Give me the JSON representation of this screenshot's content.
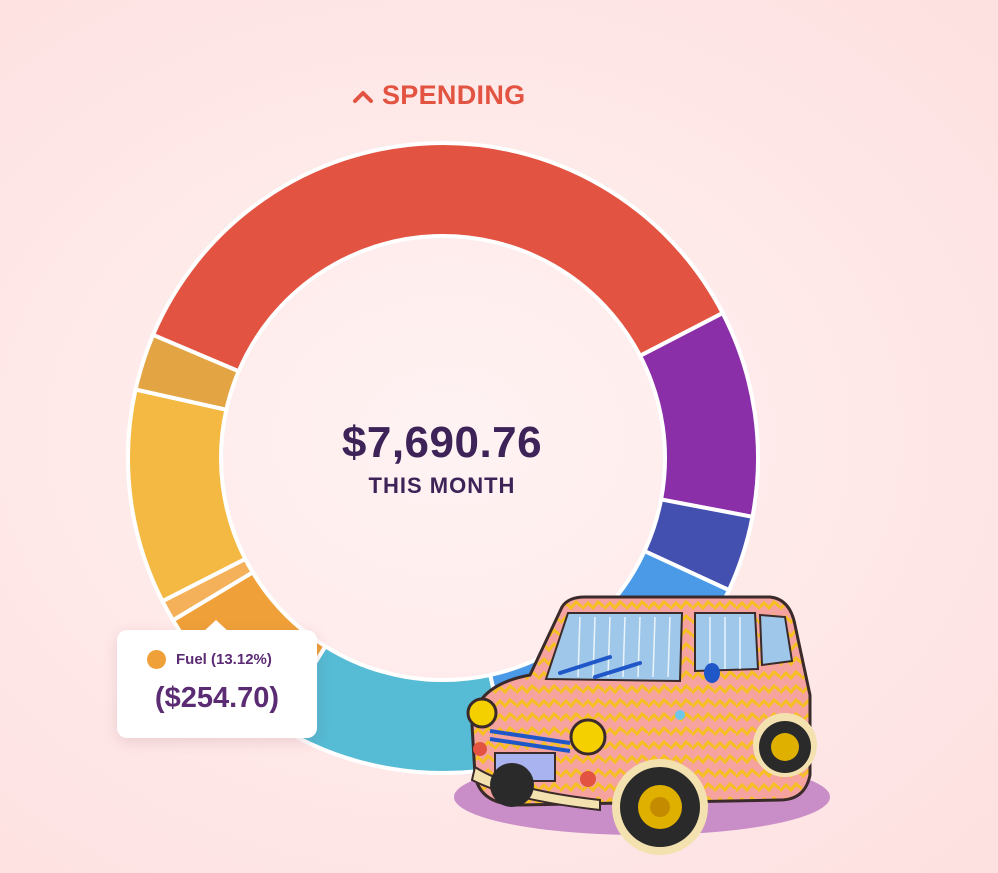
{
  "header": {
    "label": "SPENDING",
    "icon": "chevron-up-icon"
  },
  "summary": {
    "total": "$7,690.76",
    "period": "THIS MONTH"
  },
  "tooltip": {
    "label": "Fuel (13.12%)",
    "amount": "($254.70)",
    "color": "#f0a038"
  },
  "chart_data": {
    "type": "pie",
    "style": "donut",
    "total": 7690.76,
    "slices": [
      {
        "value": 36.0,
        "color": "#e25441"
      },
      {
        "value": 10.6,
        "color": "#8b2fa8"
      },
      {
        "value": 3.9,
        "color": "#4450b0"
      },
      {
        "value": 14.7,
        "color": "#4a9ae8"
      },
      {
        "value": 12.3,
        "color": "#56bbd4"
      },
      {
        "value": 7.5,
        "color": "#f0a038"
      },
      {
        "value": 1.1,
        "color": "#f4b15a"
      },
      {
        "value": 11.0,
        "color": "#f4b942"
      },
      {
        "value": 2.9,
        "color": "#e3a444"
      }
    ]
  }
}
